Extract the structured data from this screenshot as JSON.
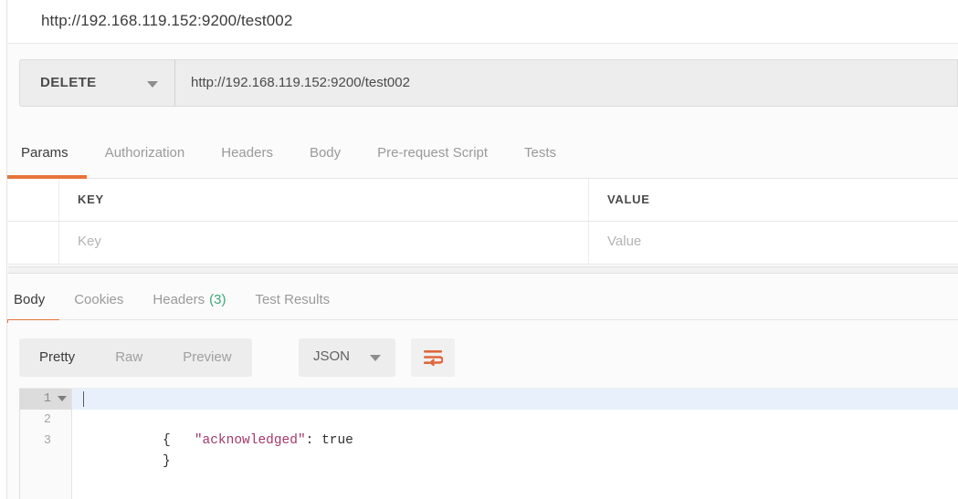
{
  "window": {
    "title": "http://192.168.119.152:9200/test002"
  },
  "request": {
    "method": "DELETE",
    "url": "http://192.168.119.152:9200/test002",
    "tabs": [
      {
        "label": "Params",
        "active": true
      },
      {
        "label": "Authorization",
        "active": false
      },
      {
        "label": "Headers",
        "active": false
      },
      {
        "label": "Body",
        "active": false
      },
      {
        "label": "Pre-request Script",
        "active": false
      },
      {
        "label": "Tests",
        "active": false
      }
    ],
    "params_table": {
      "columns": [
        "KEY",
        "VALUE"
      ],
      "rows": [
        {
          "key": "",
          "key_placeholder": "Key",
          "value": "",
          "value_placeholder": "Value",
          "checked": false
        }
      ]
    }
  },
  "response": {
    "tabs": [
      {
        "label": "Body",
        "active": true,
        "count": ""
      },
      {
        "label": "Cookies",
        "active": false,
        "count": ""
      },
      {
        "label": "Headers",
        "active": false,
        "count": "(3)"
      },
      {
        "label": "Test Results",
        "active": false,
        "count": ""
      }
    ],
    "view_modes": [
      {
        "label": "Pretty",
        "active": true
      },
      {
        "label": "Raw",
        "active": false
      },
      {
        "label": "Preview",
        "active": false
      }
    ],
    "format": "JSON",
    "wrap_button_title": "Wrap lines",
    "body": {
      "language": "json",
      "lines": [
        {
          "number": "1",
          "indent": "",
          "key": "",
          "punct": "{",
          "value": "",
          "active": true,
          "foldable": true
        },
        {
          "number": "2",
          "indent": "    ",
          "key": "\"acknowledged\"",
          "punct": ": ",
          "value": "true",
          "active": false,
          "foldable": false
        },
        {
          "number": "3",
          "indent": "",
          "key": "",
          "punct": "}",
          "value": "",
          "active": false,
          "foldable": false
        }
      ],
      "raw": "{\n    \"acknowledged\": true\n}"
    }
  },
  "colors": {
    "accent": "#e8743b",
    "success": "#3aa978",
    "json_key": "#a3386b",
    "active_line": "#e8f1fb",
    "toolbar_bg": "#ededed"
  }
}
